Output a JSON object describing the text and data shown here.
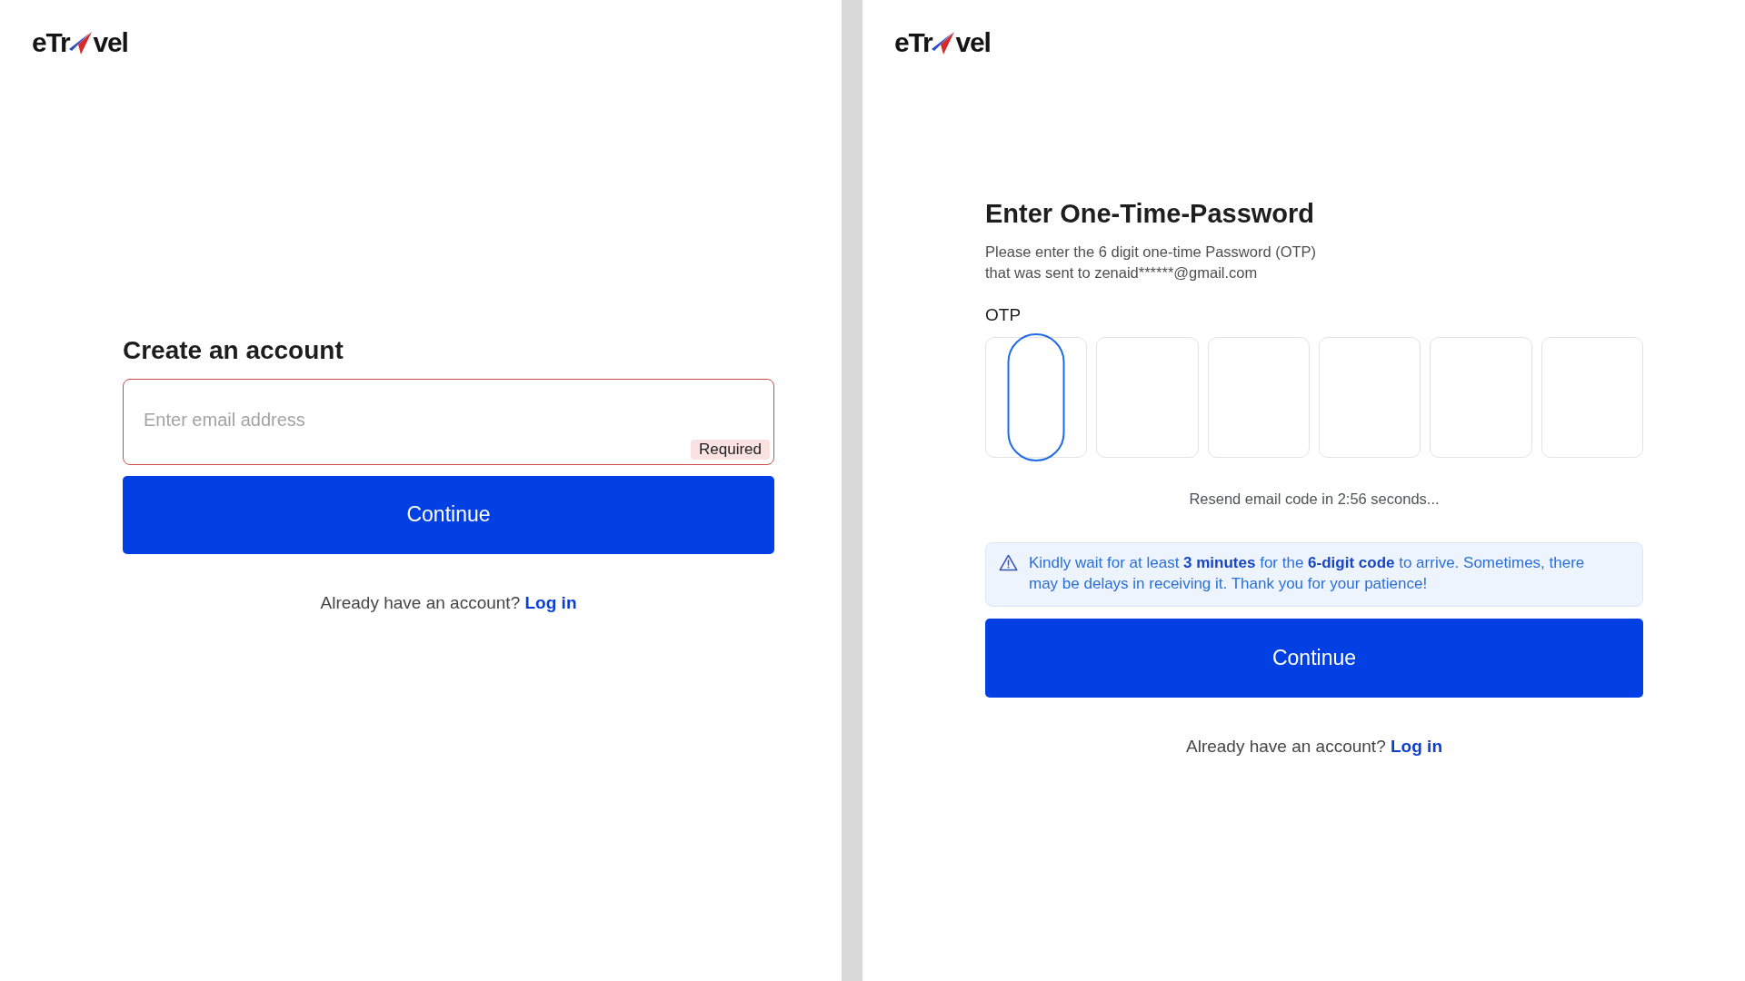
{
  "signup_screen": {
    "logo": {
      "text_start": "eTr",
      "text_end": "vel"
    },
    "title": "Create an account",
    "email_field": {
      "placeholder": "Enter email address",
      "badge": "Required",
      "error": true
    },
    "continue_button": "Continue",
    "login_prompt": {
      "text": "Already have an account?",
      "link": "Log in"
    }
  },
  "otp_screen": {
    "logo": {
      "text_start": "eTr",
      "text_end": "vel"
    },
    "title": "Enter One-Time-Password",
    "description": "Please enter the 6 digit one-time Password (OTP) that was sent to zenaid******@gmail.com",
    "otp": {
      "label": "OTP",
      "boxes": [
        {
          "focused": true
        },
        {
          "focused": false
        },
        {
          "focused": false
        },
        {
          "focused": false
        },
        {
          "focused": false
        },
        {
          "focused": false
        }
      ]
    },
    "resend_text": "Resend email code in 2:56 seconds...",
    "notice": "Kindly wait for at least **3 minutes** for the **6-digit code** to arrive. Sometimes, there may be delays in receiving it. Thank you for your patience!",
    "continue_button": "Continue",
    "login_prompt": {
      "text": "Already have an account?",
      "link": "Log in"
    }
  }
}
